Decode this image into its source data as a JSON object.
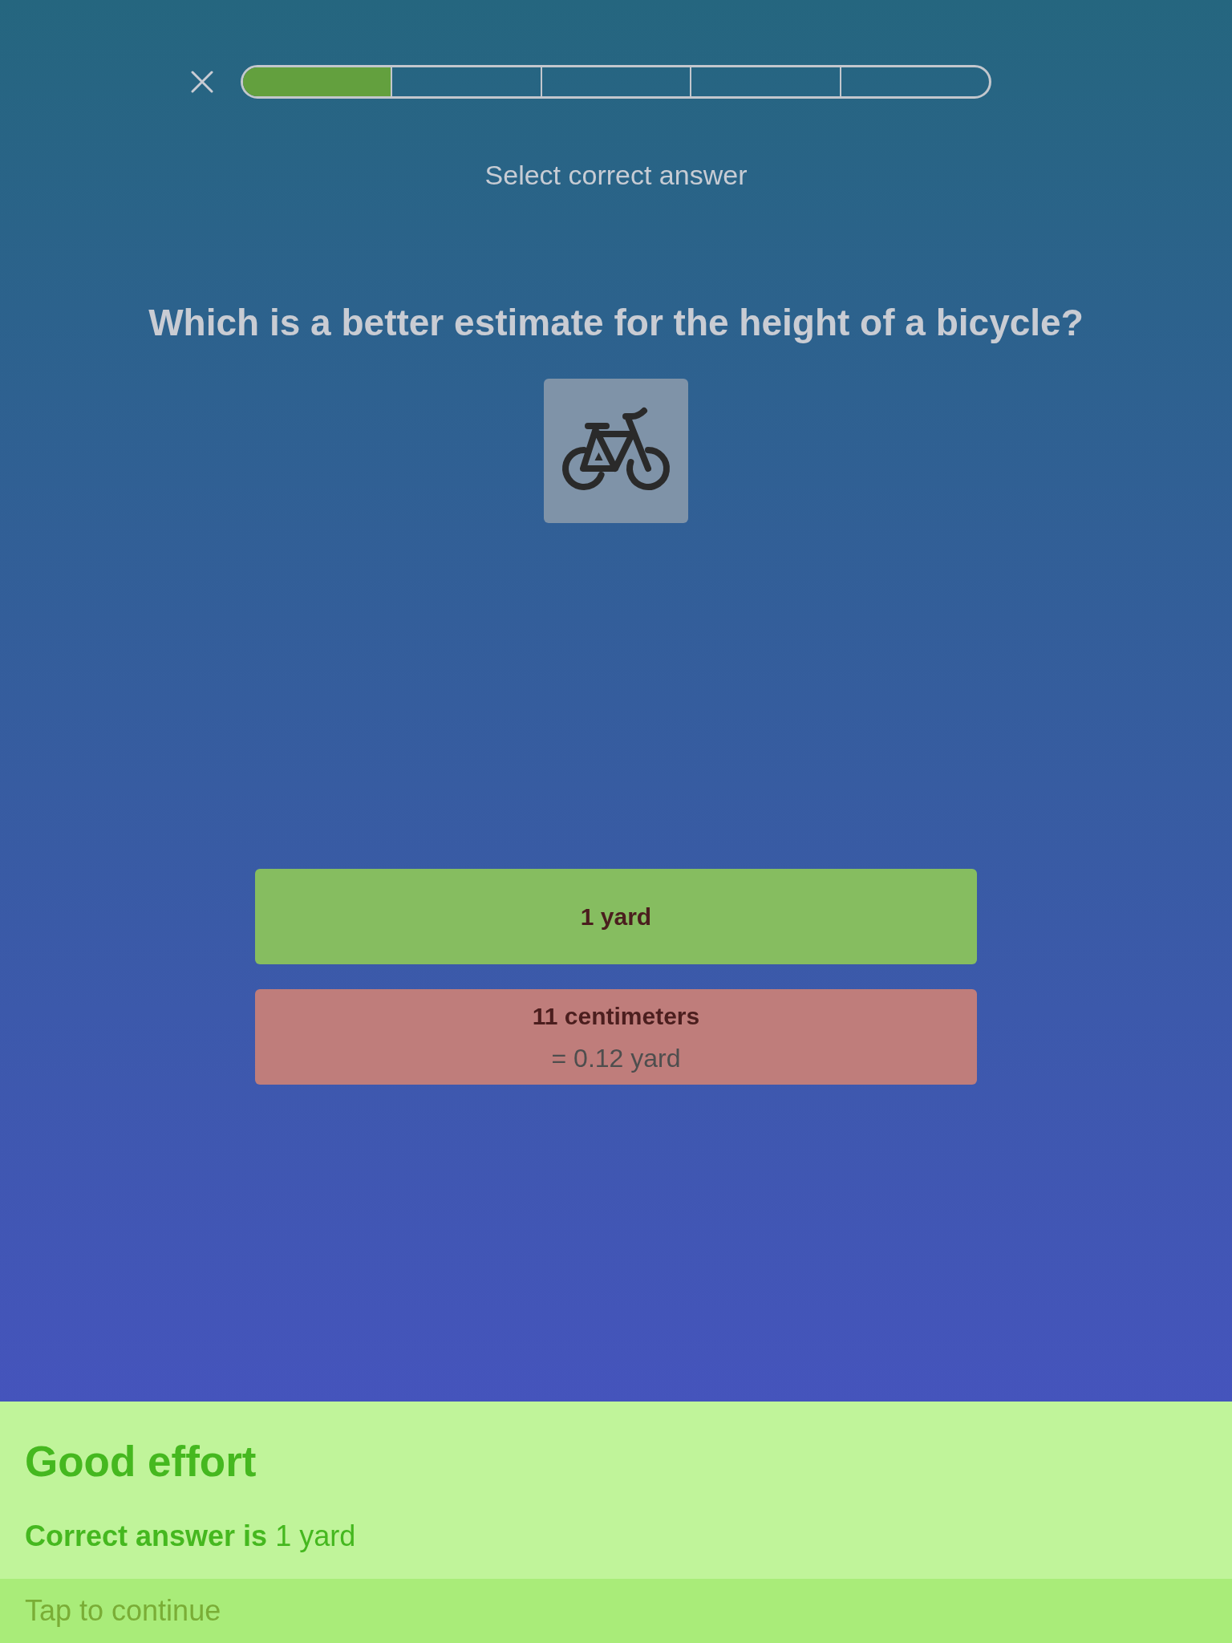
{
  "header": {
    "progress": {
      "segments": [
        {
          "filled": true
        },
        {
          "filled": false
        },
        {
          "filled": false
        },
        {
          "filled": false
        },
        {
          "filled": false
        }
      ]
    },
    "instruction": "Select correct answer"
  },
  "question": {
    "text": "Which is a better estimate for the height of a bicycle?"
  },
  "answers": [
    {
      "label": "1 yard",
      "correct": true,
      "selected": false
    },
    {
      "label": "11 centimeters",
      "detail": "= 0.12 yard",
      "correct": false,
      "selected": true
    }
  ],
  "feedback": {
    "title": "Good effort",
    "message": "**Correct answer is** 1 yard",
    "action": "Tap to continue"
  }
}
